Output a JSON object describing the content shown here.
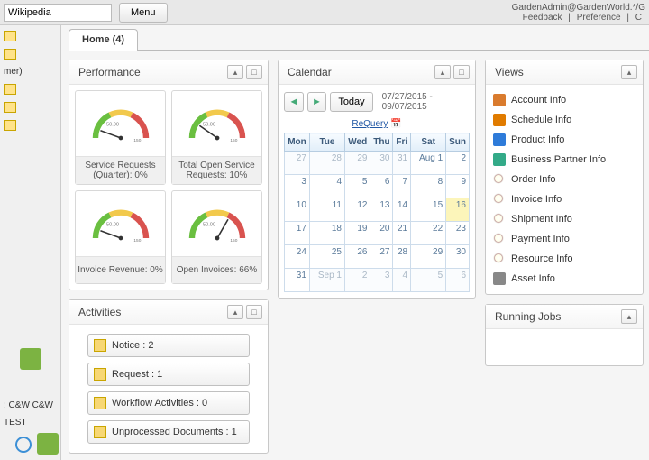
{
  "top": {
    "search_value": "Wikipedia",
    "menu_label": "Menu",
    "user_line": "GardenAdmin@GardenWorld.*/G",
    "links": [
      "Feedback",
      "Preference",
      "C"
    ]
  },
  "left": {
    "items": [
      "",
      "",
      "mer)",
      "",
      "",
      "",
      ": C&W C&W",
      "TEST"
    ]
  },
  "tab": {
    "label": "Home (4)"
  },
  "performance": {
    "title": "Performance",
    "gauges": [
      {
        "label": "Service Requests (Quarter): 0%",
        "needle": -70
      },
      {
        "label": "Total Open Service Requests: 10%",
        "needle": -55
      },
      {
        "label": "Invoice Revenue: 0%",
        "needle": -70
      },
      {
        "label": "Open Invoices: 66%",
        "needle": 30
      }
    ]
  },
  "calendar": {
    "title": "Calendar",
    "today_label": "Today",
    "range": "07/27/2015 - 09/07/2015",
    "requery": "ReQuery",
    "days": [
      "Mon",
      "Tue",
      "Wed",
      "Thu",
      "Fri",
      "Sat",
      "Sun"
    ],
    "rows": [
      [
        {
          "t": "27",
          "d": 1
        },
        {
          "t": "28",
          "d": 1
        },
        {
          "t": "29",
          "d": 1
        },
        {
          "t": "30",
          "d": 1
        },
        {
          "t": "31",
          "d": 1
        },
        {
          "t": "Aug 1",
          "d": 0
        },
        {
          "t": "2",
          "d": 0
        }
      ],
      [
        {
          "t": "3",
          "d": 0
        },
        {
          "t": "4",
          "d": 0
        },
        {
          "t": "5",
          "d": 0
        },
        {
          "t": "6",
          "d": 0
        },
        {
          "t": "7",
          "d": 0
        },
        {
          "t": "8",
          "d": 0
        },
        {
          "t": "9",
          "d": 0
        }
      ],
      [
        {
          "t": "10",
          "d": 0
        },
        {
          "t": "11",
          "d": 0
        },
        {
          "t": "12",
          "d": 0
        },
        {
          "t": "13",
          "d": 0
        },
        {
          "t": "14",
          "d": 0
        },
        {
          "t": "15",
          "d": 0
        },
        {
          "t": "16",
          "d": 0,
          "h": 1
        }
      ],
      [
        {
          "t": "17",
          "d": 0
        },
        {
          "t": "18",
          "d": 0
        },
        {
          "t": "19",
          "d": 0
        },
        {
          "t": "20",
          "d": 0
        },
        {
          "t": "21",
          "d": 0
        },
        {
          "t": "22",
          "d": 0
        },
        {
          "t": "23",
          "d": 0
        }
      ],
      [
        {
          "t": "24",
          "d": 0
        },
        {
          "t": "25",
          "d": 0
        },
        {
          "t": "26",
          "d": 0
        },
        {
          "t": "27",
          "d": 0
        },
        {
          "t": "28",
          "d": 0
        },
        {
          "t": "29",
          "d": 0
        },
        {
          "t": "30",
          "d": 0
        }
      ],
      [
        {
          "t": "31",
          "d": 0
        },
        {
          "t": "Sep 1",
          "d": 1
        },
        {
          "t": "2",
          "d": 1
        },
        {
          "t": "3",
          "d": 1
        },
        {
          "t": "4",
          "d": 1
        },
        {
          "t": "5",
          "d": 1
        },
        {
          "t": "6",
          "d": 1
        }
      ]
    ]
  },
  "views": {
    "title": "Views",
    "items": [
      {
        "icon": "account",
        "label": "Account Info"
      },
      {
        "icon": "schedule",
        "label": "Schedule Info"
      },
      {
        "icon": "product",
        "label": "Product Info"
      },
      {
        "icon": "partner",
        "label": "Business Partner Info"
      },
      {
        "icon": "bulb",
        "label": "Order Info"
      },
      {
        "icon": "bulb",
        "label": "Invoice Info"
      },
      {
        "icon": "bulb",
        "label": "Shipment Info"
      },
      {
        "icon": "bulb",
        "label": "Payment Info"
      },
      {
        "icon": "bulb",
        "label": "Resource Info"
      },
      {
        "icon": "asset",
        "label": "Asset Info"
      }
    ]
  },
  "activities": {
    "title": "Activities",
    "items": [
      {
        "label": "Notice : 2"
      },
      {
        "label": "Request : 1"
      },
      {
        "label": "Workflow Activities : 0"
      },
      {
        "label": "Unprocessed Documents : 1"
      }
    ]
  },
  "running": {
    "title": "Running Jobs"
  }
}
